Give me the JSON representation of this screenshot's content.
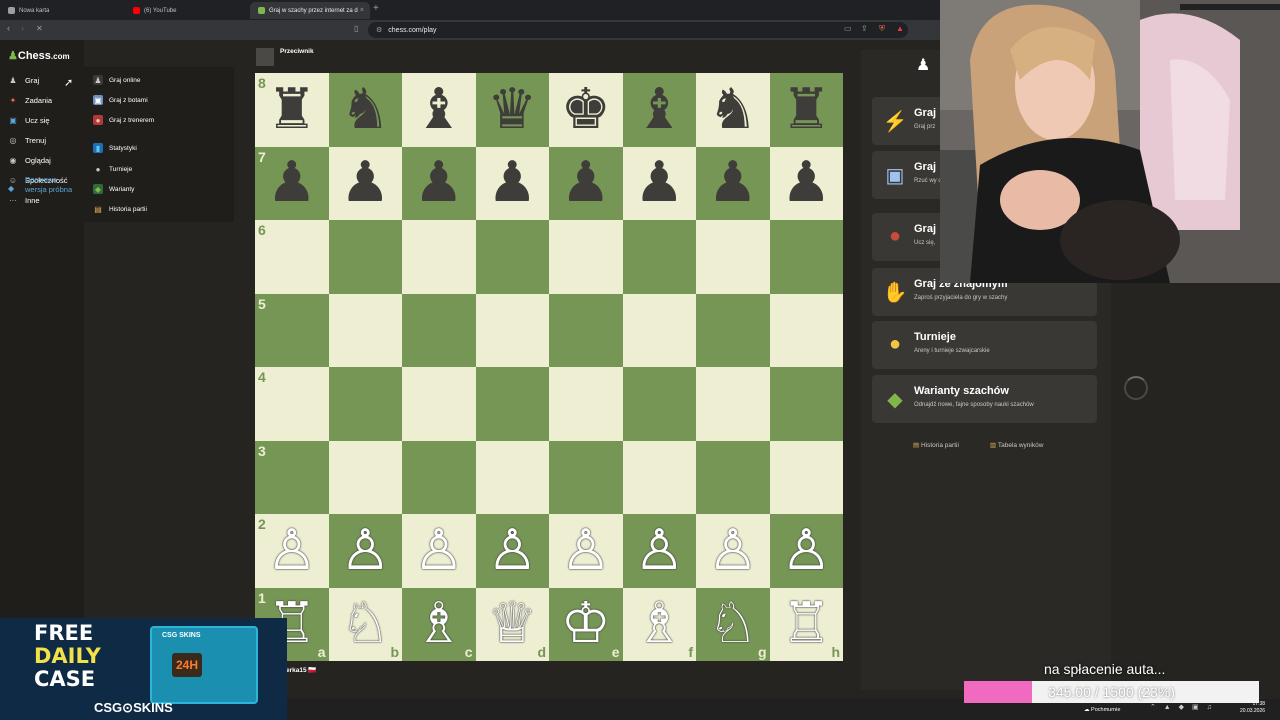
{
  "browser": {
    "tabs": [
      {
        "title": "Nowa karta",
        "icon_color": "#9aa0a6"
      },
      {
        "title": "(6) YouTube",
        "icon_color": "#ff0000"
      },
      {
        "title": "Graj w szachy przez internet za d",
        "icon_color": "#81b64c"
      }
    ],
    "new_tab": "+",
    "close_glyph": "×",
    "back": "‹",
    "forward": "›",
    "stop": "✕",
    "url": "chess.com/play"
  },
  "sidebar": {
    "logo": "Chess",
    "logo_suffix": ".com",
    "items": [
      {
        "label": "Graj",
        "icon": "pawn-icon",
        "glyph": "♟",
        "color": "#c9c7c4"
      },
      {
        "label": "Zadania",
        "icon": "puzzle-icon",
        "glyph": "✦",
        "color": "#e66b3a"
      },
      {
        "label": "Ucz się",
        "icon": "learn-icon",
        "glyph": "▣",
        "color": "#5aa6d6"
      },
      {
        "label": "Trenuj",
        "icon": "train-icon",
        "glyph": "◎",
        "color": "#c9c7c4"
      },
      {
        "label": "Oglądaj",
        "icon": "watch-icon",
        "glyph": "◉",
        "color": "#c9c7c4"
      },
      {
        "label": "Społeczność",
        "icon": "community-icon",
        "glyph": "☺",
        "color": "#c9c7c4"
      },
      {
        "label": "Inne",
        "icon": "more-icon",
        "glyph": "···",
        "color": "#c9c7c4"
      }
    ],
    "trial": "Darmowa wersja próbna"
  },
  "submenu": {
    "items": [
      {
        "label": "Graj online",
        "icon": "online-icon",
        "glyph": "♟",
        "bg": "#3a3835",
        "color": "#c9c7c4"
      },
      {
        "label": "Graj z botami",
        "icon": "bot-icon",
        "glyph": "▣",
        "bg": "#6c8fbf",
        "color": "#fff"
      },
      {
        "label": "Graj z trenerem",
        "icon": "coach-icon",
        "glyph": "●",
        "bg": "#b23a3a",
        "color": "#f0c0a0"
      },
      {
        "label": "Statystyki",
        "icon": "stats-icon",
        "glyph": "▮",
        "bg": "#1f6fb2",
        "color": "#5ac8f5"
      },
      {
        "label": "Turnieje",
        "icon": "trophy-icon",
        "glyph": "●",
        "bg": "#1f1e1b",
        "color": "#c9c7c4"
      },
      {
        "label": "Warianty",
        "icon": "variants-icon",
        "glyph": "◆",
        "bg": "#2f6a3a",
        "color": "#81b64c"
      },
      {
        "label": "Historia partii",
        "icon": "history-icon",
        "glyph": "▤",
        "bg": "#1f1e1b",
        "color": "#e0b050"
      }
    ]
  },
  "board": {
    "opponent": "Przeciwnik",
    "player": "erka15 🇵🇱",
    "ranks": [
      "8",
      "7",
      "6",
      "5",
      "4",
      "3",
      "2",
      "1"
    ],
    "files": [
      "a",
      "b",
      "c",
      "d",
      "e",
      "f",
      "g",
      "h"
    ],
    "position": [
      [
        "♜",
        "♞",
        "♝",
        "♛",
        "♚",
        "♝",
        "♞",
        "♜"
      ],
      [
        "♟",
        "♟",
        "♟",
        "♟",
        "♟",
        "♟",
        "♟",
        "♟"
      ],
      [
        "",
        "",
        "",
        "",
        "",
        "",
        "",
        ""
      ],
      [
        "",
        "",
        "",
        "",
        "",
        "",
        "",
        ""
      ],
      [
        "",
        "",
        "",
        "",
        "",
        "",
        "",
        ""
      ],
      [
        "",
        "",
        "",
        "",
        "",
        "",
        "",
        ""
      ],
      [
        "♙",
        "♙",
        "♙",
        "♙",
        "♙",
        "♙",
        "♙",
        "♙"
      ],
      [
        "♖",
        "♘",
        "♗",
        "♕",
        "♔",
        "♗",
        "♘",
        "♖"
      ]
    ],
    "colors": {
      "light": "#eeeed2",
      "dark": "#769656"
    }
  },
  "right_panel": {
    "cards": [
      {
        "title": "Graj",
        "sub": "Graj prz",
        "icon": "lightning-icon",
        "glyph": "⚡",
        "color": "#f4c542"
      },
      {
        "title": "Graj",
        "sub": "Rzuć wy do mistr",
        "icon": "computer-icon",
        "glyph": "▣",
        "color": "#9fc3f0"
      },
      {
        "title": "Graj",
        "sub": "Ucz się,",
        "icon": "coach-icon",
        "glyph": "●",
        "color": "#c84a3a"
      },
      {
        "title": "Graj ze znajomym",
        "sub": "Zaproś przyjaciela do gry w szachy",
        "icon": "handshake-icon",
        "glyph": "✋",
        "color": "#e8b890"
      },
      {
        "title": "Turnieje",
        "sub": "Areny i turnieje szwajcarskie",
        "icon": "medal-icon",
        "glyph": "●",
        "color": "#f4c542"
      },
      {
        "title": "Warianty szachów",
        "sub": "Odnajdź nowe, fajne sposoby nauki szachów",
        "icon": "variants-icon",
        "glyph": "◆",
        "color": "#81b64c"
      }
    ],
    "links": [
      {
        "label": "Historia partii",
        "icon": "history-icon",
        "glyph": "▤"
      },
      {
        "label": "Tabela wyników",
        "icon": "leaderboard-icon",
        "glyph": "▥"
      }
    ]
  },
  "ad": {
    "line1": "FREE",
    "line2": "DAILY",
    "line3": "CASE",
    "box_label": "CSG SKINS",
    "box_timer": "24H",
    "brand": "CSG⊙SKINS"
  },
  "donation": {
    "caption": "na spłacenie auta...",
    "value_text": "345.00 / 1500 (23%)",
    "progress": 0.23,
    "bar_color": "#f06ac0"
  },
  "taskbar": {
    "weather": "Pochmurnie",
    "time": "17:38",
    "date": "20.03.2026"
  }
}
